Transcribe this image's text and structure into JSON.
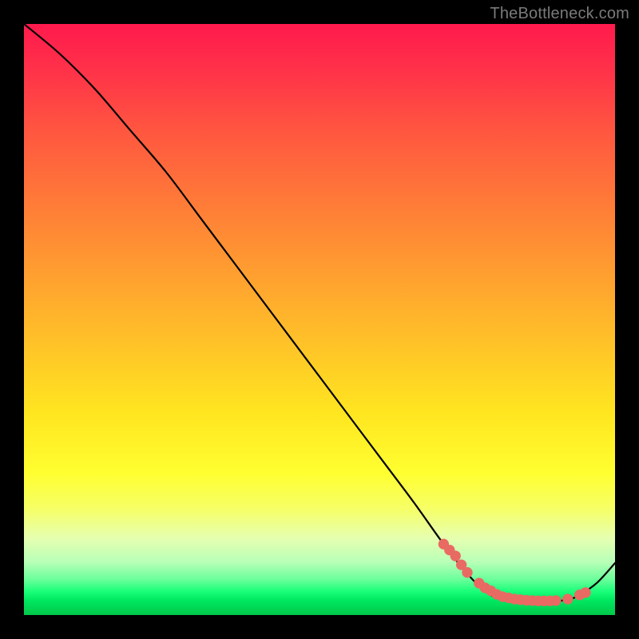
{
  "watermark": "TheBottleneck.com",
  "chart_data": {
    "type": "line",
    "title": "",
    "xlabel": "",
    "ylabel": "",
    "xlim": [
      0,
      100
    ],
    "ylim": [
      0,
      100
    ],
    "grid": false,
    "legend": false,
    "series": [
      {
        "name": "bottleneck-curve",
        "x": [
          0,
          6,
          12,
          18,
          24,
          30,
          36,
          42,
          48,
          54,
          60,
          66,
          71,
          75,
          78,
          80,
          83,
          86,
          89,
          92,
          94,
          97,
          100
        ],
        "y": [
          100,
          95,
          89,
          82,
          75,
          67,
          59,
          51,
          43,
          35,
          27,
          19,
          12,
          7,
          4,
          3,
          2.5,
          2.3,
          2.3,
          2.6,
          3.4,
          5.5,
          8.8
        ]
      }
    ],
    "points": {
      "name": "highlight-points",
      "color": "#e96a63",
      "x": [
        71,
        72,
        73,
        74,
        75,
        77,
        78,
        79,
        80,
        81,
        82,
        83,
        84,
        85,
        86,
        87,
        88,
        89,
        90,
        92,
        94,
        95
      ],
      "y": [
        12,
        11,
        10,
        8.5,
        7.2,
        5.4,
        4.6,
        4.1,
        3.5,
        3.1,
        2.9,
        2.7,
        2.6,
        2.5,
        2.45,
        2.4,
        2.4,
        2.4,
        2.45,
        2.7,
        3.4,
        3.8
      ]
    }
  }
}
